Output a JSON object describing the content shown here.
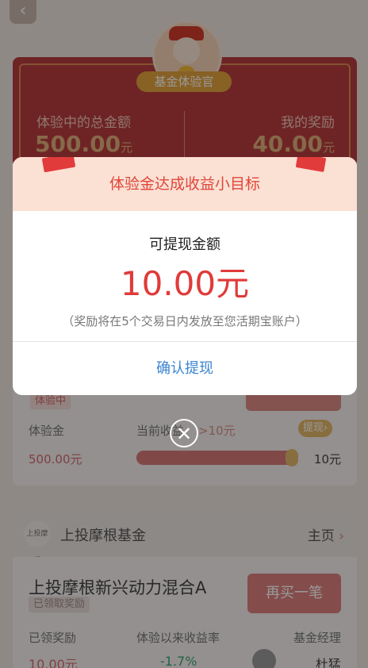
{
  "header": {
    "back_icon": "chevron-left-icon",
    "badge": "基金体验官"
  },
  "summary": {
    "total_label": "体验中的总金额",
    "total_value": "500.00",
    "total_unit": "元",
    "reward_label": "我的奖励",
    "reward_value": "40.00",
    "reward_unit": "元"
  },
  "experience_card": {
    "status": "体验中",
    "fund_label": "体验金",
    "fund_value": "500.00元",
    "earnings_label": "当前收益",
    "earnings_value": ">10元",
    "withdraw_label": "提现",
    "withdraw_chevron": "›",
    "progress_fraction": 1.0,
    "target_value": "10元"
  },
  "fund": {
    "logo_text": "上投摩根",
    "name": "上投摩根基金",
    "home_label": "主页",
    "home_chevron": "›",
    "product_title": "上投摩根新兴动力混合A",
    "claimed_badge": "已领取奖励",
    "buy_again_label": "再买一笔",
    "claimed_reward_label": "已领奖励",
    "claimed_reward_value": "10.00元",
    "return_label": "体验以来收益率",
    "return_value": "-1.7%",
    "manager_label": "基金经理",
    "manager_name": "杜猛"
  },
  "modal": {
    "title": "体验金达成收益小目标",
    "amount_label": "可提现金额",
    "amount": "10.00元",
    "note": "（奖励将在5个交易日内发放至您活期宝账户）",
    "confirm_label": "确认提现",
    "close_icon": "close-icon",
    "close_glyph": "✕"
  },
  "colors": {
    "accent_red": "#e03a3a",
    "confirm_blue": "#3a84d0",
    "gain_green": "#3fa57a"
  }
}
